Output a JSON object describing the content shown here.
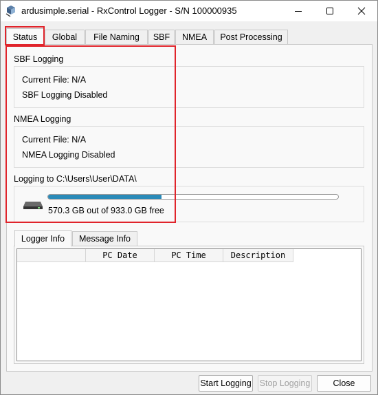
{
  "window": {
    "title": "ardusimple.serial - RxControl Logger - S/N 100000935"
  },
  "tabs": [
    {
      "label": "Status"
    },
    {
      "label": "Global"
    },
    {
      "label": "File Naming"
    },
    {
      "label": "SBF"
    },
    {
      "label": "NMEA"
    },
    {
      "label": "Post Processing"
    }
  ],
  "sbf": {
    "heading": "SBF Logging",
    "current_file": "Current File:  N/A",
    "status": "SBF Logging Disabled"
  },
  "nmea": {
    "heading": "NMEA Logging",
    "current_file": "Current File:  N/A",
    "status": "NMEA Logging Disabled"
  },
  "storage": {
    "heading": "Logging to C:\\Users\\User\\DATA\\",
    "free_text": "570.3 GB out of 933.0 GB free",
    "used_fraction": 0.39
  },
  "inner_tabs": [
    {
      "label": "Logger Info"
    },
    {
      "label": "Message Info"
    }
  ],
  "table": {
    "columns": [
      "",
      "PC Date",
      "PC Time",
      "Description"
    ]
  },
  "buttons": {
    "start": "Start Logging",
    "stop": "Stop Logging",
    "close": "Close"
  },
  "colors": {
    "highlight": "#e0242b",
    "progress": "#2a8ab8"
  }
}
